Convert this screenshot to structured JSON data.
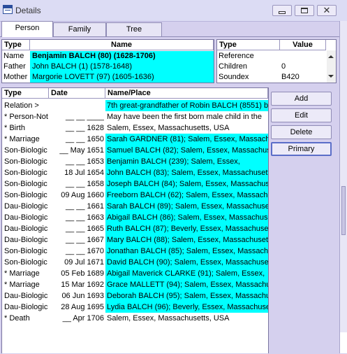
{
  "window": {
    "title": "Details"
  },
  "tabs": [
    {
      "label": "Person",
      "active": true
    },
    {
      "label": "Family",
      "active": false
    },
    {
      "label": "Tree",
      "active": false
    }
  ],
  "names_table": {
    "headers": [
      "Type",
      "Name"
    ],
    "rows": [
      {
        "type": "Name",
        "name": "Benjamin BALCH (80)  (1628-1706)",
        "bold": true
      },
      {
        "type": "Father",
        "name": "John BALCH (1)  (1578-1648)",
        "bold": false
      },
      {
        "type": "Mother",
        "name": "Margorie LOVETT (97)  (1605-1636)",
        "bold": false
      }
    ]
  },
  "attrs_table": {
    "headers": [
      "Type",
      "Value"
    ],
    "rows": [
      {
        "type": "Reference",
        "value": ""
      },
      {
        "type": "Children",
        "value": "0"
      },
      {
        "type": "Soundex",
        "value": "B420"
      }
    ]
  },
  "events_table": {
    "headers": [
      "Type",
      "Date",
      "Name/Place"
    ],
    "rows": [
      {
        "type": "Relation >",
        "date": "",
        "place": "7th great-grandfather of Robin BALCH (8551) b.",
        "hl": true
      },
      {
        "type": "* Person-Not",
        "date": "__ __ ____",
        "place": "May have been the first born male child in the",
        "hl": false
      },
      {
        "type": "* Birth",
        "date": "__ __ 1628",
        "place": "Salem, Essex, Massachusetts, USA",
        "hl": false
      },
      {
        "type": "* Marriage",
        "date": "__ __ 1650",
        "place": "Sarah GARDNER (81); Salem, Essex, Massachus",
        "hl": true
      },
      {
        "type": "Son-Biologic",
        "date": "__ May 1651",
        "place": "Samuel BALCH (82); Salem, Essex, Massachuset",
        "hl": true
      },
      {
        "type": "Son-Biologic",
        "date": "__ __ 1653",
        "place": "Benjamin BALCH (239); Salem, Essex,",
        "hl": true
      },
      {
        "type": "Son-Biologic",
        "date": "18 Jul 1654",
        "place": "John BALCH (83); Salem, Essex, Massachusetts,",
        "hl": true
      },
      {
        "type": "Son-Biologic",
        "date": "__ __ 1658",
        "place": "Joseph BALCH (84); Salem, Essex, Massachuset",
        "hl": true
      },
      {
        "type": "Son-Biologic",
        "date": "09 Aug 1660",
        "place": "Freeborn BALCH (62); Salem, Essex, Massachus",
        "hl": true
      },
      {
        "type": "Dau-Biologic",
        "date": "__ __ 1661",
        "place": "Sarah BALCH (89); Salem, Essex, Massachusetts",
        "hl": true
      },
      {
        "type": "Dau-Biologic",
        "date": "__ __ 1663",
        "place": "Abigail BALCH (86); Salem, Essex, Massachuset",
        "hl": true
      },
      {
        "type": "Dau-Biologic",
        "date": "__ __ 1665",
        "place": "Ruth BALCH (87); Beverly, Essex, Massachusett",
        "hl": true
      },
      {
        "type": "Dau-Biologic",
        "date": "__ __ 1667",
        "place": "Mary BALCH (88); Salem, Essex, Massachusetts,",
        "hl": true
      },
      {
        "type": "Son-Biologic",
        "date": "__ __ 1670",
        "place": "Jonathan BALCH (85); Salem, Essex, Massachus",
        "hl": true
      },
      {
        "type": "Son-Biologic",
        "date": "09 Jul 1671",
        "place": "David BALCH (90); Salem, Essex, Massachusetts",
        "hl": true
      },
      {
        "type": "* Marriage",
        "date": "05 Feb 1689",
        "place": "Abigail Maverick CLARKE (91); Salem, Essex,",
        "hl": true
      },
      {
        "type": "* Marriage",
        "date": "15 Mar 1692",
        "place": "Grace MALLETT (94); Salem, Essex, Massachuse",
        "hl": true
      },
      {
        "type": "Dau-Biologic",
        "date": "06 Jun 1693",
        "place": "Deborah BALCH (95); Salem, Essex, Massachuse",
        "hl": true
      },
      {
        "type": "Dau-Biologic",
        "date": "28 Aug 1695",
        "place": "Lydia BALCH (96); Beverly, Essex, Massachusett",
        "hl": true
      },
      {
        "type": "* Death",
        "date": "__ Apr 1706",
        "place": "Salem, Essex, Massachusetts, USA",
        "hl": false
      }
    ]
  },
  "buttons": {
    "add": "Add",
    "edit": "Edit",
    "delete": "Delete",
    "primary": "Primary"
  },
  "colors": {
    "highlight": "#00ffff",
    "background": "#d5d0ee"
  }
}
